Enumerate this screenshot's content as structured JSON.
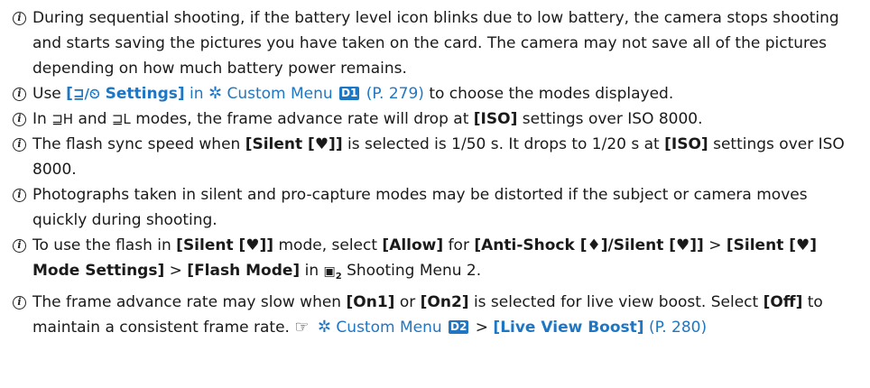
{
  "icons": {
    "note": "i",
    "drive_timer": "⊒/⏲",
    "gear": "✲",
    "ref": "☞",
    "high": "⊒H",
    "low": "⊒L",
    "shoot_menu": "▣"
  },
  "notes": [
    {
      "text": "During sequential shooting, if the battery level icon blinks due to low battery, the camera stops shooting and starts saving the pictures you have taken on the card. The camera may not save all of the pictures depending on how much battery power remains."
    },
    {
      "use": "Use",
      "settings_bold": "[",
      "settings_label": " Settings]",
      "in": "in",
      "custom_menu": "Custom Menu",
      "badge": "D1",
      "page_ref": "(P. 279)",
      "rest": "to choose the modes displayed."
    },
    {
      "in": "In",
      "and": "and",
      "rest1": "modes, the frame advance rate will drop at",
      "iso": "[ISO]",
      "rest2": "settings over ISO 8000."
    },
    {
      "pre": "The flash sync speed when",
      "silent": "[Silent [♥]]",
      "mid": "is selected is 1/50 s. It drops to 1/20 s at",
      "iso": "[ISO]",
      "post": "settings over ISO 8000."
    },
    {
      "text": "Photographs taken in silent and pro-capture modes may be distorted if the subject or camera moves quickly during shooting."
    },
    {
      "pre": "To use the flash in",
      "silent": "[Silent [♥]]",
      "mode_select": "mode, select",
      "allow": "[Allow]",
      "for": "for",
      "anti": "[Anti-Shock [♦]/Silent [♥]]",
      "gt1": ">",
      "silent_mode": "[Silent [♥] Mode Settings]",
      "gt2": ">",
      "flash_mode": "[Flash Mode]",
      "in": "in",
      "menu_sub": "2",
      "menu": "Shooting Menu 2."
    },
    {
      "pre": "The frame advance rate may slow when",
      "on1": "[On1]",
      "or": "or",
      "on2": "[On2]",
      "mid": "is selected for live view boost. Select",
      "off": "[Off]",
      "post": "to maintain a consistent frame rate.",
      "custom_menu": "Custom Menu",
      "badge": "D2",
      "gt": ">",
      "boost": "[Live View Boost]",
      "page_ref": "(P. 280)"
    }
  ]
}
